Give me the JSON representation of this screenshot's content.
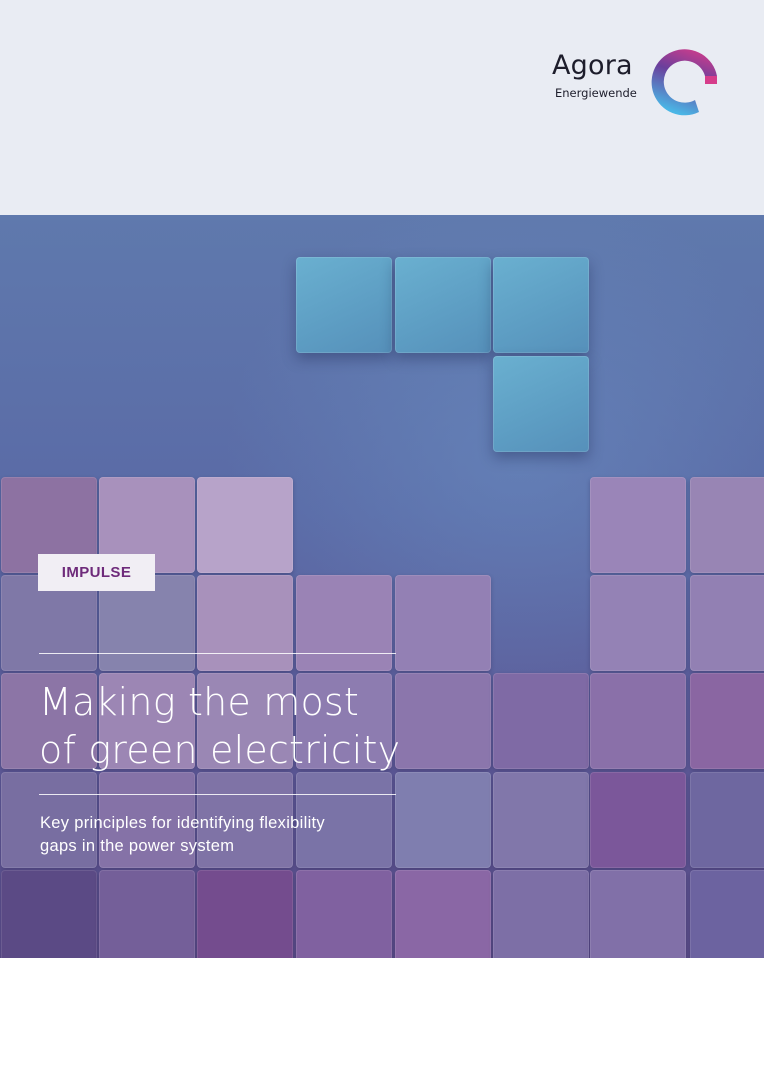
{
  "brand": {
    "name": "Agora",
    "subline": "Energiewende",
    "colors": {
      "gradient_top": "#c23c8e",
      "gradient_mid": "#6a3f9c",
      "gradient_bottom": "#4ab0e4"
    }
  },
  "cover": {
    "label": "IMPULSE",
    "title_line1": "Making the most",
    "title_line2": "of green electricity",
    "subtitle_line1": "Key principles for identifying flexibility",
    "subtitle_line2": "gaps in the power system"
  },
  "colors": {
    "header_bg": "#e9ecf3",
    "label_text": "#6e2a7a",
    "falling_block": "#5fa0c6"
  }
}
